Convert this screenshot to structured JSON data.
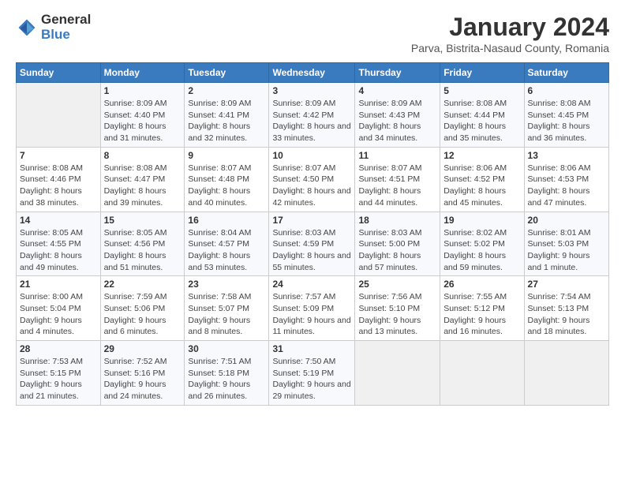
{
  "header": {
    "logo_general": "General",
    "logo_blue": "Blue",
    "title": "January 2024",
    "subtitle": "Parva, Bistrita-Nasaud County, Romania"
  },
  "weekdays": [
    "Sunday",
    "Monday",
    "Tuesday",
    "Wednesday",
    "Thursday",
    "Friday",
    "Saturday"
  ],
  "weeks": [
    [
      {
        "day": "",
        "sunrise": "",
        "sunset": "",
        "daylight": ""
      },
      {
        "day": "1",
        "sunrise": "Sunrise: 8:09 AM",
        "sunset": "Sunset: 4:40 PM",
        "daylight": "Daylight: 8 hours and 31 minutes."
      },
      {
        "day": "2",
        "sunrise": "Sunrise: 8:09 AM",
        "sunset": "Sunset: 4:41 PM",
        "daylight": "Daylight: 8 hours and 32 minutes."
      },
      {
        "day": "3",
        "sunrise": "Sunrise: 8:09 AM",
        "sunset": "Sunset: 4:42 PM",
        "daylight": "Daylight: 8 hours and 33 minutes."
      },
      {
        "day": "4",
        "sunrise": "Sunrise: 8:09 AM",
        "sunset": "Sunset: 4:43 PM",
        "daylight": "Daylight: 8 hours and 34 minutes."
      },
      {
        "day": "5",
        "sunrise": "Sunrise: 8:08 AM",
        "sunset": "Sunset: 4:44 PM",
        "daylight": "Daylight: 8 hours and 35 minutes."
      },
      {
        "day": "6",
        "sunrise": "Sunrise: 8:08 AM",
        "sunset": "Sunset: 4:45 PM",
        "daylight": "Daylight: 8 hours and 36 minutes."
      }
    ],
    [
      {
        "day": "7",
        "sunrise": "Sunrise: 8:08 AM",
        "sunset": "Sunset: 4:46 PM",
        "daylight": "Daylight: 8 hours and 38 minutes."
      },
      {
        "day": "8",
        "sunrise": "Sunrise: 8:08 AM",
        "sunset": "Sunset: 4:47 PM",
        "daylight": "Daylight: 8 hours and 39 minutes."
      },
      {
        "day": "9",
        "sunrise": "Sunrise: 8:07 AM",
        "sunset": "Sunset: 4:48 PM",
        "daylight": "Daylight: 8 hours and 40 minutes."
      },
      {
        "day": "10",
        "sunrise": "Sunrise: 8:07 AM",
        "sunset": "Sunset: 4:50 PM",
        "daylight": "Daylight: 8 hours and 42 minutes."
      },
      {
        "day": "11",
        "sunrise": "Sunrise: 8:07 AM",
        "sunset": "Sunset: 4:51 PM",
        "daylight": "Daylight: 8 hours and 44 minutes."
      },
      {
        "day": "12",
        "sunrise": "Sunrise: 8:06 AM",
        "sunset": "Sunset: 4:52 PM",
        "daylight": "Daylight: 8 hours and 45 minutes."
      },
      {
        "day": "13",
        "sunrise": "Sunrise: 8:06 AM",
        "sunset": "Sunset: 4:53 PM",
        "daylight": "Daylight: 8 hours and 47 minutes."
      }
    ],
    [
      {
        "day": "14",
        "sunrise": "Sunrise: 8:05 AM",
        "sunset": "Sunset: 4:55 PM",
        "daylight": "Daylight: 8 hours and 49 minutes."
      },
      {
        "day": "15",
        "sunrise": "Sunrise: 8:05 AM",
        "sunset": "Sunset: 4:56 PM",
        "daylight": "Daylight: 8 hours and 51 minutes."
      },
      {
        "day": "16",
        "sunrise": "Sunrise: 8:04 AM",
        "sunset": "Sunset: 4:57 PM",
        "daylight": "Daylight: 8 hours and 53 minutes."
      },
      {
        "day": "17",
        "sunrise": "Sunrise: 8:03 AM",
        "sunset": "Sunset: 4:59 PM",
        "daylight": "Daylight: 8 hours and 55 minutes."
      },
      {
        "day": "18",
        "sunrise": "Sunrise: 8:03 AM",
        "sunset": "Sunset: 5:00 PM",
        "daylight": "Daylight: 8 hours and 57 minutes."
      },
      {
        "day": "19",
        "sunrise": "Sunrise: 8:02 AM",
        "sunset": "Sunset: 5:02 PM",
        "daylight": "Daylight: 8 hours and 59 minutes."
      },
      {
        "day": "20",
        "sunrise": "Sunrise: 8:01 AM",
        "sunset": "Sunset: 5:03 PM",
        "daylight": "Daylight: 9 hours and 1 minute."
      }
    ],
    [
      {
        "day": "21",
        "sunrise": "Sunrise: 8:00 AM",
        "sunset": "Sunset: 5:04 PM",
        "daylight": "Daylight: 9 hours and 4 minutes."
      },
      {
        "day": "22",
        "sunrise": "Sunrise: 7:59 AM",
        "sunset": "Sunset: 5:06 PM",
        "daylight": "Daylight: 9 hours and 6 minutes."
      },
      {
        "day": "23",
        "sunrise": "Sunrise: 7:58 AM",
        "sunset": "Sunset: 5:07 PM",
        "daylight": "Daylight: 9 hours and 8 minutes."
      },
      {
        "day": "24",
        "sunrise": "Sunrise: 7:57 AM",
        "sunset": "Sunset: 5:09 PM",
        "daylight": "Daylight: 9 hours and 11 minutes."
      },
      {
        "day": "25",
        "sunrise": "Sunrise: 7:56 AM",
        "sunset": "Sunset: 5:10 PM",
        "daylight": "Daylight: 9 hours and 13 minutes."
      },
      {
        "day": "26",
        "sunrise": "Sunrise: 7:55 AM",
        "sunset": "Sunset: 5:12 PM",
        "daylight": "Daylight: 9 hours and 16 minutes."
      },
      {
        "day": "27",
        "sunrise": "Sunrise: 7:54 AM",
        "sunset": "Sunset: 5:13 PM",
        "daylight": "Daylight: 9 hours and 18 minutes."
      }
    ],
    [
      {
        "day": "28",
        "sunrise": "Sunrise: 7:53 AM",
        "sunset": "Sunset: 5:15 PM",
        "daylight": "Daylight: 9 hours and 21 minutes."
      },
      {
        "day": "29",
        "sunrise": "Sunrise: 7:52 AM",
        "sunset": "Sunset: 5:16 PM",
        "daylight": "Daylight: 9 hours and 24 minutes."
      },
      {
        "day": "30",
        "sunrise": "Sunrise: 7:51 AM",
        "sunset": "Sunset: 5:18 PM",
        "daylight": "Daylight: 9 hours and 26 minutes."
      },
      {
        "day": "31",
        "sunrise": "Sunrise: 7:50 AM",
        "sunset": "Sunset: 5:19 PM",
        "daylight": "Daylight: 9 hours and 29 minutes."
      },
      {
        "day": "",
        "sunrise": "",
        "sunset": "",
        "daylight": ""
      },
      {
        "day": "",
        "sunrise": "",
        "sunset": "",
        "daylight": ""
      },
      {
        "day": "",
        "sunrise": "",
        "sunset": "",
        "daylight": ""
      }
    ]
  ]
}
